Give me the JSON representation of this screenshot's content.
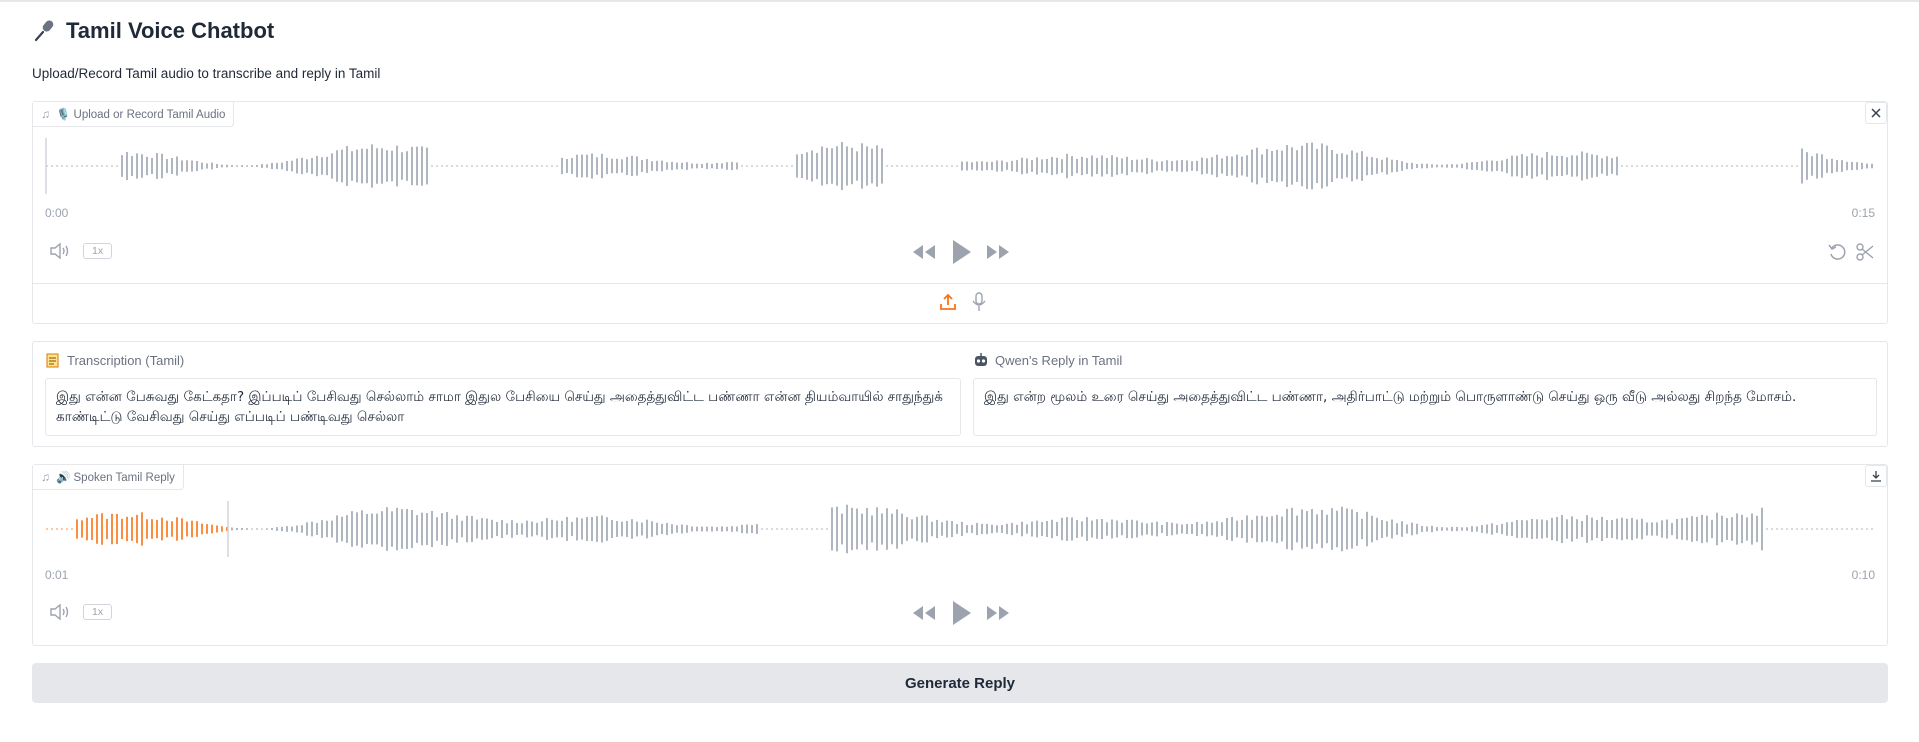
{
  "header": {
    "title": "Tamil Voice Chatbot",
    "subtitle": "Upload/Record Tamil audio to transcribe and reply in Tamil"
  },
  "input_audio": {
    "label": "🎙️ Upload or Record Tamil Audio",
    "current_time": "0:00",
    "duration": "0:15",
    "speed": "1x",
    "progress": 0.0
  },
  "transcription": {
    "label": "Transcription (Tamil)",
    "text": "இது என்ன பேசுவது கேட்கதா? இப்படிப் பேசிவது செல்லாம் சாமா இதுல பேசியை செய்து அதைத்துவிட்ட பண்ணா என்ன தியம்வாயில் சாதுந்துக் காண்டிட்டு வேசிவது செய்து எப்படிப் பண்டிவது செல்லா"
  },
  "reply": {
    "label": "Qwen's Reply in Tamil",
    "text": "இது என்ற மூலம் உரை செய்து அதைத்துவிட்ட பண்ணா, அதிர்பாட்டு மற்றும் பொருளாண்டு செய்து ஒரு வீடு அல்லது சிறந்த மோசம்."
  },
  "output_audio": {
    "label": "🔊 Spoken Tamil Reply",
    "current_time": "0:01",
    "duration": "0:10",
    "speed": "1x",
    "progress": 0.1
  },
  "actions": {
    "generate_label": "Generate Reply"
  },
  "colors": {
    "accent": "#f97316",
    "wave": "#9ca3af",
    "border": "#e5e7eb"
  },
  "icons": [
    "microphone-icon",
    "music-note-icon",
    "close-icon",
    "volume-icon",
    "rewind-icon",
    "play-icon",
    "forward-icon",
    "undo-icon",
    "scissors-icon",
    "upload-icon",
    "mic-icon",
    "memo-icon",
    "robot-icon",
    "download-icon"
  ]
}
